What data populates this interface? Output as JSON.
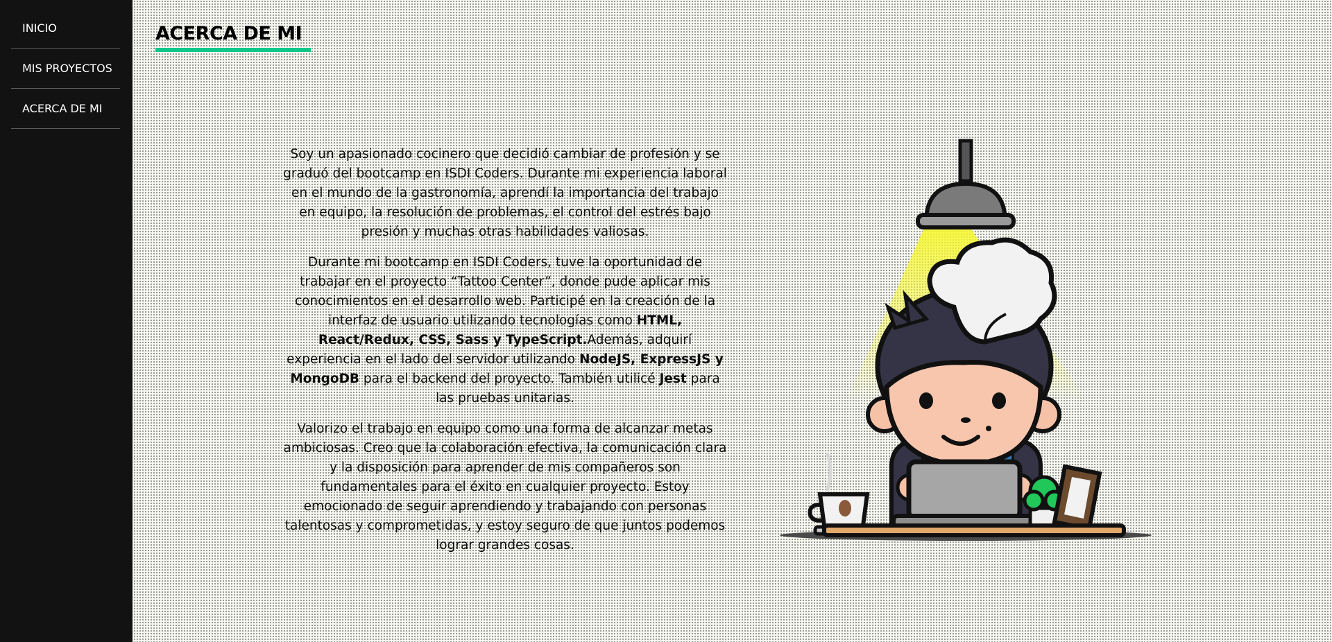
{
  "sidebar": {
    "items": [
      {
        "label": "INICIO"
      },
      {
        "label": "MIS PROYECTOS"
      },
      {
        "label": "ACERCA DE MI"
      }
    ]
  },
  "header": {
    "title": "ACERCA DE MI",
    "accent_color": "#10c78a"
  },
  "about": {
    "p1": "Soy un apasionado cocinero que decidió cambiar de profesión y se graduó del bootcamp en ISDI Coders. Durante mi experiencia laboral en el mundo de la gastronomía, aprendí la importancia del trabajo en equipo, la resolución de problemas, el control del estrés bajo presión y muchas otras habilidades valiosas.",
    "p2": {
      "t1": "Durante mi bootcamp en ISDI Coders, tuve la oportunidad de trabajar en el proyecto “Tattoo Center”, donde pude aplicar mis conocimientos en el desarrollo web. Participé en la creación de la interfaz de usuario utilizando tecnologías como ",
      "b1": "HTML, React/Redux, CSS, Sass y TypeScript.",
      "t2": "Además, adquirí experiencia en el lado del servidor utilizando ",
      "b2": "NodeJS, ExpressJS y MongoDB",
      "t3": " para el backend del proyecto. También utilicé ",
      "b3": "Jest",
      "t4": " para las pruebas unitarias."
    },
    "p3": "Valorizo el trabajo en equipo como una forma de alcanzar metas ambiciosas. Creo que la colaboración efectiva, la comunicación clara y la disposición para aprender de mis compañeros son fundamentales para el éxito en cualquier proyecto. Estoy emocionado de seguir aprendiendo y trabajando con personas talentosas y comprometidas, y estoy seguro de que juntos podemos lograr grandes cosas."
  },
  "illustration": {
    "icon": "chef-at-laptop-illustration"
  }
}
